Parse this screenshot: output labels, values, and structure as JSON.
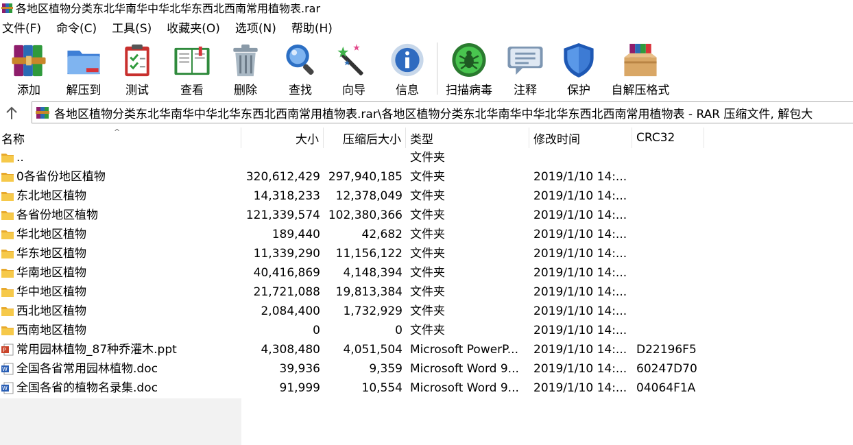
{
  "window": {
    "title": "各地区植物分类东北华南华中华北华东西北西南常用植物表.rar"
  },
  "menu": [
    "文件(F)",
    "命令(C)",
    "工具(S)",
    "收藏夹(O)",
    "选项(N)",
    "帮助(H)"
  ],
  "toolbar": {
    "add": "添加",
    "extract": "解压到",
    "test": "测试",
    "view": "查看",
    "delete": "删除",
    "find": "查找",
    "wizard": "向导",
    "info": "信息",
    "scan": "扫描病毒",
    "comment": "注释",
    "protect": "保护",
    "sfx": "自解压格式"
  },
  "path": {
    "text": "各地区植物分类东北华南华中华北华东西北西南常用植物表.rar\\各地区植物分类东北华南华中华北华东西北西南常用植物表 - RAR 压缩文件, 解包大"
  },
  "columns": {
    "name": "名称",
    "size": "大小",
    "packed": "压缩后大小",
    "type": "类型",
    "modified": "修改时间",
    "crc": "CRC32"
  },
  "files": [
    {
      "name": "..",
      "size": "",
      "packed": "",
      "type": "文件夹",
      "modified": "",
      "crc": "",
      "icon": "folder-icon"
    },
    {
      "name": "0各省份地区植物",
      "size": "320,612,429",
      "packed": "297,940,185",
      "type": "文件夹",
      "modified": "2019/1/10 14:...",
      "crc": "",
      "icon": "folder-icon"
    },
    {
      "name": "东北地区植物",
      "size": "14,318,233",
      "packed": "12,378,049",
      "type": "文件夹",
      "modified": "2019/1/10 14:...",
      "crc": "",
      "icon": "folder-icon"
    },
    {
      "name": "各省份地区植物",
      "size": "121,339,574",
      "packed": "102,380,366",
      "type": "文件夹",
      "modified": "2019/1/10 14:...",
      "crc": "",
      "icon": "folder-icon"
    },
    {
      "name": "华北地区植物",
      "size": "189,440",
      "packed": "42,682",
      "type": "文件夹",
      "modified": "2019/1/10 14:...",
      "crc": "",
      "icon": "folder-icon"
    },
    {
      "name": "华东地区植物",
      "size": "11,339,290",
      "packed": "11,156,122",
      "type": "文件夹",
      "modified": "2019/1/10 14:...",
      "crc": "",
      "icon": "folder-icon"
    },
    {
      "name": "华南地区植物",
      "size": "40,416,869",
      "packed": "4,148,394",
      "type": "文件夹",
      "modified": "2019/1/10 14:...",
      "crc": "",
      "icon": "folder-icon"
    },
    {
      "name": "华中地区植物",
      "size": "21,721,088",
      "packed": "19,813,384",
      "type": "文件夹",
      "modified": "2019/1/10 14:...",
      "crc": "",
      "icon": "folder-icon"
    },
    {
      "name": "西北地区植物",
      "size": "2,084,400",
      "packed": "1,732,929",
      "type": "文件夹",
      "modified": "2019/1/10 14:...",
      "crc": "",
      "icon": "folder-icon"
    },
    {
      "name": "西南地区植物",
      "size": "0",
      "packed": "0",
      "type": "文件夹",
      "modified": "2019/1/10 14:...",
      "crc": "",
      "icon": "folder-icon"
    },
    {
      "name": "常用园林植物_87种乔灌木.ppt",
      "size": "4,308,480",
      "packed": "4,051,504",
      "type": "Microsoft PowerP...",
      "modified": "2019/1/10 14:...",
      "crc": "D22196F5",
      "icon": "ppt-file-icon"
    },
    {
      "name": "全国各省常用园林植物.doc",
      "size": "39,936",
      "packed": "9,359",
      "type": "Microsoft Word 9...",
      "modified": "2019/1/10 14:...",
      "crc": "60247D70",
      "icon": "word-file-icon"
    },
    {
      "name": "全国各省的植物名录集.doc",
      "size": "91,999",
      "packed": "10,554",
      "type": "Microsoft Word 9...",
      "modified": "2019/1/10 14:...",
      "crc": "04064F1A",
      "icon": "word-file-icon"
    }
  ]
}
